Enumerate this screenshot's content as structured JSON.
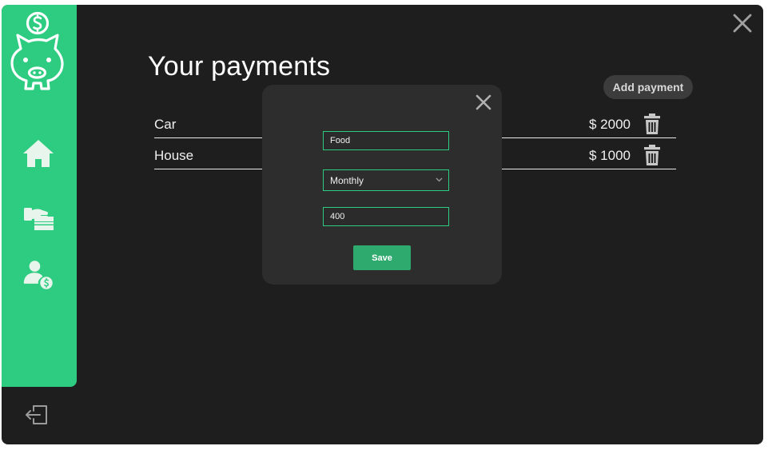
{
  "app": {
    "accent_color": "#2ecc81",
    "background_color": "#1e1e1e"
  },
  "sidebar": {
    "logo_icon": "piggy-bank-dollar-icon",
    "items": [
      {
        "id": "home",
        "icon": "home-icon"
      },
      {
        "id": "payments",
        "icon": "hand-card-payment-icon"
      },
      {
        "id": "account",
        "icon": "user-dollar-icon"
      }
    ],
    "logout_icon": "logout-icon"
  },
  "header": {
    "title": "Your payments",
    "add_button_label": "Add payment",
    "close_icon": "close-icon"
  },
  "payments": [
    {
      "name": "Car",
      "amount": "$ 2000"
    },
    {
      "name": "House",
      "amount": "$ 1000"
    }
  ],
  "modal": {
    "name_value": "Food",
    "frequency_value": "Monthly",
    "amount_value": "400",
    "save_label": "Save",
    "close_icon": "close-icon"
  }
}
